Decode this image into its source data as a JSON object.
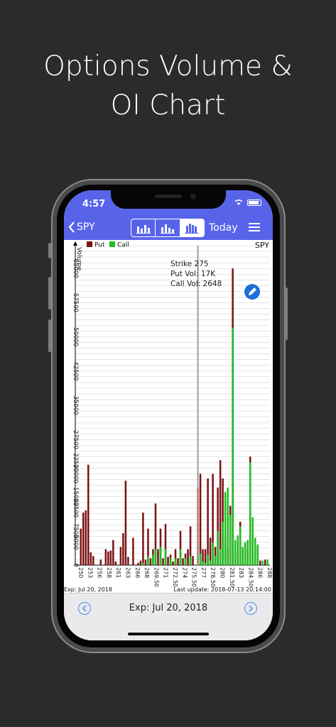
{
  "headline": {
    "line1": "Options Volume &",
    "line2": "OI Chart"
  },
  "status": {
    "time": "4:57"
  },
  "nav": {
    "back_label": "SPY",
    "today_label": "Today",
    "icons": [
      "chevron-left-icon",
      "bar-chart-icon",
      "stacked-bar-icon",
      "grouped-bar-icon",
      "list-icon"
    ]
  },
  "footer": {
    "exp_label": "Exp: Jul 20, 2018"
  },
  "colors": {
    "put": "#7b1316",
    "call": "#1fbf1f",
    "accent": "#5764ea",
    "highlight": "#ff0000"
  },
  "chart_data": {
    "type": "bar",
    "symbol": "SPY",
    "ylabel": "Volume",
    "legend": [
      "Put",
      "Call"
    ],
    "legend_position": "top-left",
    "ylim": [
      0,
      70000
    ],
    "y_ticks": [
      "0",
      "5000",
      "7500",
      "12500",
      "15000",
      "20000",
      "22500",
      "27500",
      "35000",
      "42500",
      "50000",
      "57500",
      "65000"
    ],
    "x_tick_labels": [
      "250",
      "253",
      "256",
      "258",
      "261",
      "263",
      "266",
      "268",
      "269.50",
      "271",
      "272.50",
      "274",
      "275.50",
      "277",
      "278.50",
      "280",
      "281.50",
      "283",
      "284.50",
      "286",
      "288"
    ],
    "tooltip": {
      "strike": "Strike 275",
      "put_vol": "Put Vol: 17K",
      "call_vol": "Call Vol: 2648"
    },
    "footer_left": "Exp: Jul 20, 2018",
    "footer_right": "Last update: 2018-07-13 20:14:00",
    "highlight_index": 48,
    "puts": [
      0,
      8000,
      11500,
      12000,
      22000,
      2800,
      2000,
      0,
      0,
      1200,
      0,
      3500,
      3000,
      3200,
      5500,
      800,
      0,
      4000,
      7000,
      18500,
      1800,
      0,
      6000,
      0,
      500,
      1000,
      11500,
      1200,
      8000,
      1500,
      3500,
      13500,
      3500,
      8000,
      1500,
      9000,
      1800,
      2300,
      800,
      3500,
      1500,
      7500,
      1500,
      2500,
      3500,
      8500,
      2000,
      0,
      17000,
      20000,
      3500,
      3500,
      19000,
      6000,
      20000,
      4000,
      17000,
      23000,
      19000,
      6000,
      3500,
      13000,
      65000,
      3500,
      2500,
      9500,
      3500,
      5000,
      3500,
      23800,
      6500,
      3500,
      4000,
      1000,
      800,
      1200,
      500
    ],
    "calls": [
      0,
      0,
      0,
      0,
      0,
      0,
      0,
      0,
      0,
      0,
      0,
      0,
      0,
      0,
      0,
      0,
      0,
      0,
      0,
      0,
      0,
      0,
      0,
      0,
      0,
      0,
      500,
      0,
      2000,
      0,
      2300,
      3500,
      0,
      4000,
      0,
      3500,
      0,
      1500,
      0,
      1500,
      0,
      3500,
      0,
      1500,
      0,
      2000,
      0,
      0,
      2648,
      2500,
      800,
      500,
      2300,
      1000,
      5000,
      2000,
      7500,
      3500,
      9500,
      16000,
      17000,
      11000,
      52000,
      5500,
      6500,
      8500,
      4000,
      5000,
      5500,
      22500,
      10500,
      6000,
      4500,
      0,
      1000,
      0,
      1200
    ]
  }
}
